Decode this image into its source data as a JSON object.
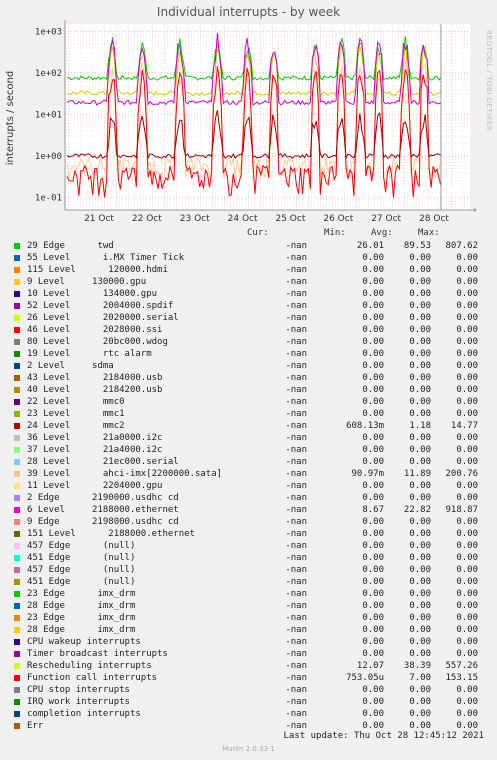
{
  "title": "Individual interrupts - by week",
  "watermark": "RRDTOOL / TOBI OETIKER",
  "chart_data": {
    "type": "line",
    "ylabel": "interrupts / second",
    "yscale": "log",
    "ylim": [
      0.05,
      1500
    ],
    "yticks": [
      "1e-01",
      "1e+00",
      "1e+01",
      "1e+02",
      "1e+03"
    ],
    "xticks": [
      "21 Oct",
      "22 Oct",
      "23 Oct",
      "24 Oct",
      "25 Oct",
      "26 Oct",
      "27 Oct",
      "28 Oct"
    ],
    "series": [
      {
        "name": "29 Edge twd",
        "color": "#00cc00",
        "min": 26.01,
        "avg": 89.53,
        "max": 807.62
      },
      {
        "name": "Rescheduling interrupts",
        "color": "#cccc00",
        "min": 12.07,
        "avg": 38.39,
        "max": 557.26
      },
      {
        "name": "6 Level 2188000.ethernet",
        "color": "#cc00cc",
        "min": 8.67,
        "avg": 22.82,
        "max": 918.87
      },
      {
        "name": "39 Level ahci-imx[2200000.sata]",
        "color": "#ffcc99",
        "min": 0.091,
        "avg": 11.89,
        "max": 200.76
      },
      {
        "name": "Function call interrupts",
        "color": "#ff0000",
        "min": 0.00075,
        "avg": 7.0,
        "max": 153.15
      },
      {
        "name": "24 Level mmc2",
        "color": "#990000",
        "min": 0.608,
        "avg": 1.18,
        "max": 14.77
      }
    ]
  },
  "legend": {
    "headers": {
      "cur": "Cur:",
      "min": "Min:",
      "avg": "Avg:",
      "max": "Max:"
    },
    "rows": [
      {
        "color": "#00cc00",
        "label": "29 Edge      twd",
        "cur": "-nan",
        "min": "26.01",
        "avg": "89.53",
        "max": "807.62"
      },
      {
        "color": "#0066b3",
        "label": "55 Level      i.MX Timer Tick",
        "cur": "-nan",
        "min": "0.00",
        "avg": "0.00",
        "max": "0.00"
      },
      {
        "color": "#ff8000",
        "label": "115 Level      120000.hdmi",
        "cur": "-nan",
        "min": "0.00",
        "avg": "0.00",
        "max": "0.00"
      },
      {
        "color": "#ffcc00",
        "label": "9 Level     130000.gpu",
        "cur": "-nan",
        "min": "0.00",
        "avg": "0.00",
        "max": "0.00"
      },
      {
        "color": "#330099",
        "label": "10 Level      134000.gpu",
        "cur": "-nan",
        "min": "0.00",
        "avg": "0.00",
        "max": "0.00"
      },
      {
        "color": "#990099",
        "label": "52 Level      2004000.spdif",
        "cur": "-nan",
        "min": "0.00",
        "avg": "0.00",
        "max": "0.00"
      },
      {
        "color": "#ccff00",
        "label": "26 Level      2020000.serial",
        "cur": "-nan",
        "min": "0.00",
        "avg": "0.00",
        "max": "0.00"
      },
      {
        "color": "#ff0000",
        "label": "46 Level      2028000.ssi",
        "cur": "-nan",
        "min": "0.00",
        "avg": "0.00",
        "max": "0.00"
      },
      {
        "color": "#808080",
        "label": "80 Level      20bc000.wdog",
        "cur": "-nan",
        "min": "0.00",
        "avg": "0.00",
        "max": "0.00"
      },
      {
        "color": "#008f00",
        "label": "19 Level      rtc alarm",
        "cur": "-nan",
        "min": "0.00",
        "avg": "0.00",
        "max": "0.00"
      },
      {
        "color": "#00487d",
        "label": "2 Level     sdma",
        "cur": "-nan",
        "min": "0.00",
        "avg": "0.00",
        "max": "0.00"
      },
      {
        "color": "#b35a00",
        "label": "43 Level      2184000.usb",
        "cur": "-nan",
        "min": "0.00",
        "avg": "0.00",
        "max": "0.00"
      },
      {
        "color": "#b38f00",
        "label": "40 Level      2184200.usb",
        "cur": "-nan",
        "min": "0.00",
        "avg": "0.00",
        "max": "0.00"
      },
      {
        "color": "#6b006b",
        "label": "22 Level      mmc0",
        "cur": "-nan",
        "min": "0.00",
        "avg": "0.00",
        "max": "0.00"
      },
      {
        "color": "#8fb300",
        "label": "23 Level      mmc1",
        "cur": "-nan",
        "min": "0.00",
        "avg": "0.00",
        "max": "0.00"
      },
      {
        "color": "#b30000",
        "label": "24 Level      mmc2",
        "cur": "-nan",
        "min": "608.13m",
        "avg": "1.18",
        "max": "14.77"
      },
      {
        "color": "#bebebe",
        "label": "36 Level      21a0000.i2c",
        "cur": "-nan",
        "min": "0.00",
        "avg": "0.00",
        "max": "0.00"
      },
      {
        "color": "#80ff80",
        "label": "37 Level      21a4000.i2c",
        "cur": "-nan",
        "min": "0.00",
        "avg": "0.00",
        "max": "0.00"
      },
      {
        "color": "#80c9ff",
        "label": "28 Level      21ec000.serial",
        "cur": "-nan",
        "min": "0.00",
        "avg": "0.00",
        "max": "0.00"
      },
      {
        "color": "#ffc080",
        "label": "39 Level      ahci-imx[2200000.sata]",
        "cur": "-nan",
        "min": "90.97m",
        "avg": "11.89",
        "max": "200.76"
      },
      {
        "color": "#ffe680",
        "label": "11 Level      2204000.gpu",
        "cur": "-nan",
        "min": "0.00",
        "avg": "0.00",
        "max": "0.00"
      },
      {
        "color": "#aa80ff",
        "label": "2 Edge      2190000.usdhc cd",
        "cur": "-nan",
        "min": "0.00",
        "avg": "0.00",
        "max": "0.00"
      },
      {
        "color": "#ee00cc",
        "label": "6 Level     2188000.ethernet",
        "cur": "-nan",
        "min": "8.67",
        "avg": "22.82",
        "max": "918.87"
      },
      {
        "color": "#ff8080",
        "label": "9 Edge      2198000.usdhc cd",
        "cur": "-nan",
        "min": "0.00",
        "avg": "0.00",
        "max": "0.00"
      },
      {
        "color": "#666600",
        "label": "151 Level      2188000.ethernet",
        "cur": "-nan",
        "min": "0.00",
        "avg": "0.00",
        "max": "0.00"
      },
      {
        "color": "#ffbfff",
        "label": "457 Edge      (null)",
        "cur": "-nan",
        "min": "0.00",
        "avg": "0.00",
        "max": "0.00"
      },
      {
        "color": "#00ffcc",
        "label": "451 Edge      (null)",
        "cur": "-nan",
        "min": "0.00",
        "avg": "0.00",
        "max": "0.00"
      },
      {
        "color": "#cc6699",
        "label": "457 Edge      (null)",
        "cur": "-nan",
        "min": "0.00",
        "avg": "0.00",
        "max": "0.00"
      },
      {
        "color": "#999900",
        "label": "451 Edge      (null)",
        "cur": "-nan",
        "min": "0.00",
        "avg": "0.00",
        "max": "0.00"
      },
      {
        "color": "#00cc00",
        "label": "23 Edge      imx_drm",
        "cur": "-nan",
        "min": "0.00",
        "avg": "0.00",
        "max": "0.00"
      },
      {
        "color": "#0066b3",
        "label": "28 Edge      imx_drm",
        "cur": "-nan",
        "min": "0.00",
        "avg": "0.00",
        "max": "0.00"
      },
      {
        "color": "#ff8000",
        "label": "23 Edge      imx_drm",
        "cur": "-nan",
        "min": "0.00",
        "avg": "0.00",
        "max": "0.00"
      },
      {
        "color": "#ffcc00",
        "label": "28 Edge      imx_drm",
        "cur": "-nan",
        "min": "0.00",
        "avg": "0.00",
        "max": "0.00"
      },
      {
        "color": "#330099",
        "label": "CPU wakeup interrupts",
        "cur": "-nan",
        "min": "0.00",
        "avg": "0.00",
        "max": "0.00"
      },
      {
        "color": "#990099",
        "label": "Timer broadcast interrupts",
        "cur": "-nan",
        "min": "0.00",
        "avg": "0.00",
        "max": "0.00"
      },
      {
        "color": "#ccff00",
        "label": "Rescheduling interrupts",
        "cur": "-nan",
        "min": "12.07",
        "avg": "38.39",
        "max": "557.26"
      },
      {
        "color": "#ff0000",
        "label": "Function call interrupts",
        "cur": "-nan",
        "min": "753.05u",
        "avg": "7.00",
        "max": "153.15"
      },
      {
        "color": "#808080",
        "label": "CPU stop interrupts",
        "cur": "-nan",
        "min": "0.00",
        "avg": "0.00",
        "max": "0.00"
      },
      {
        "color": "#008f00",
        "label": "IRQ work interrupts",
        "cur": "-nan",
        "min": "0.00",
        "avg": "0.00",
        "max": "0.00"
      },
      {
        "color": "#00487d",
        "label": "completion interrupts",
        "cur": "-nan",
        "min": "0.00",
        "avg": "0.00",
        "max": "0.00"
      },
      {
        "color": "#b35a00",
        "label": "Err",
        "cur": "-nan",
        "min": "0.00",
        "avg": "0.00",
        "max": "0.00"
      }
    ]
  },
  "footer": {
    "last_update": "Last update:  Thu Oct 28 12:45:12 2021"
  },
  "version": "Munin 2.0.33-1"
}
